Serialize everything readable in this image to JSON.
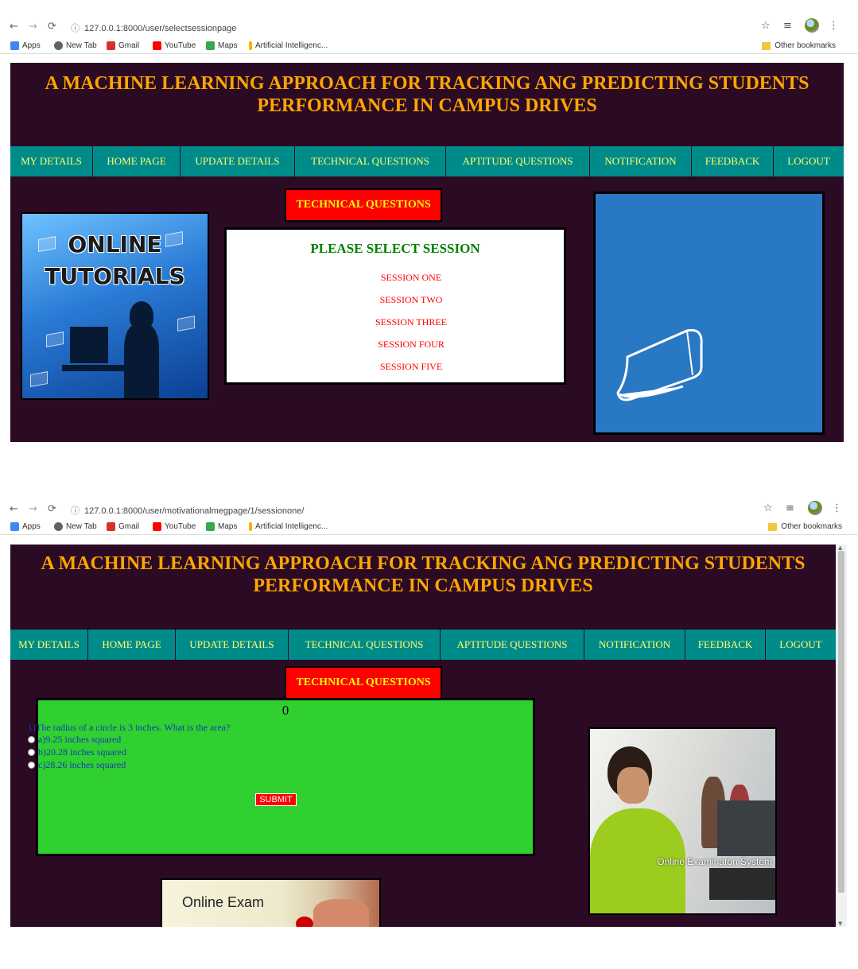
{
  "browser": {
    "nav_icons": [
      "arrow-left-icon",
      "arrow-right-icon",
      "reload-icon",
      "info-icon"
    ],
    "bookmarks": [
      {
        "label": "Apps",
        "icon": "apps-grid-icon",
        "color": "#4285f4"
      },
      {
        "label": "New Tab",
        "icon": "newtab-icon",
        "color": "#5f6368"
      },
      {
        "label": "Gmail",
        "icon": "gmail-icon",
        "color": "#d93025"
      },
      {
        "label": "YouTube",
        "icon": "youtube-icon",
        "color": "#ff0000"
      },
      {
        "label": "Maps",
        "icon": "maps-icon",
        "color": "#34a853"
      },
      {
        "label": "Artificial Intelligenc...",
        "icon": "page-icon",
        "color": "#f4b400"
      }
    ],
    "other_bookmarks": "Other bookmarks"
  },
  "shot1": {
    "url": "127.0.0.1:8000/user/selectsessionpage",
    "site_title": "A MACHINE LEARNING APPROACH FOR TRACKING ANG PREDICTING STUDENTS PERFORMANCE IN CAMPUS DRIVES",
    "menu": [
      "MY DETAILS",
      "HOME PAGE",
      "UPDATE DETAILS",
      "TECHNICAL QUESTIONS",
      "APTITUDE QUESTIONS",
      "NOTIFICATION",
      "FEEDBACK",
      "LOGOUT"
    ],
    "section_header": "TECHNICAL QUESTIONS",
    "tutorial_image_text": [
      "ONLINE",
      "TUTORIALS"
    ],
    "session_title": "PLEASE SELECT SESSION",
    "sessions": [
      "SESSION ONE",
      "SESSION TWO",
      "SESSION THREE",
      "SESSION FOUR",
      "SESSION FIVE"
    ]
  },
  "shot2": {
    "url": "127.0.0.1:8000/user/motivationalmegpage/1/sessionone/",
    "site_title": "A MACHINE LEARNING APPROACH FOR TRACKING ANG PREDICTING STUDENTS PERFORMANCE IN CAMPUS DRIVES",
    "menu": [
      "MY DETAILS",
      "HOME PAGE",
      "UPDATE DETAILS",
      "TECHNICAL QUESTIONS",
      "APTITUDE QUESTIONS",
      "NOTIFICATION",
      "FEEDBACK",
      "LOGOUT"
    ],
    "section_header": "TECHNICAL QUESTIONS",
    "quiz": {
      "counter": "0",
      "question": "1)The radius of a circle is 3 inches. What is the area?",
      "options": [
        "a)9.25 inches squared",
        "b)20.28 inches squared",
        "c)28.26 inches squared"
      ],
      "submit": "SUBMIT"
    },
    "exam_image_caption": "Online Exam",
    "lab_image_caption": "Online Examinaton System"
  },
  "colors": {
    "page_bg": "#2b0a23",
    "title": "#ffa500",
    "menu_bg": "#008b8b",
    "menu_text": "#ffff66",
    "header_bg": "#ff0000",
    "header_text": "#ffff00",
    "session_title": "#008000",
    "session_link": "#ff0000",
    "quiz_bg": "#2fd030",
    "quiz_text": "#1a3cb4",
    "blue_panel": "#2878c4"
  }
}
